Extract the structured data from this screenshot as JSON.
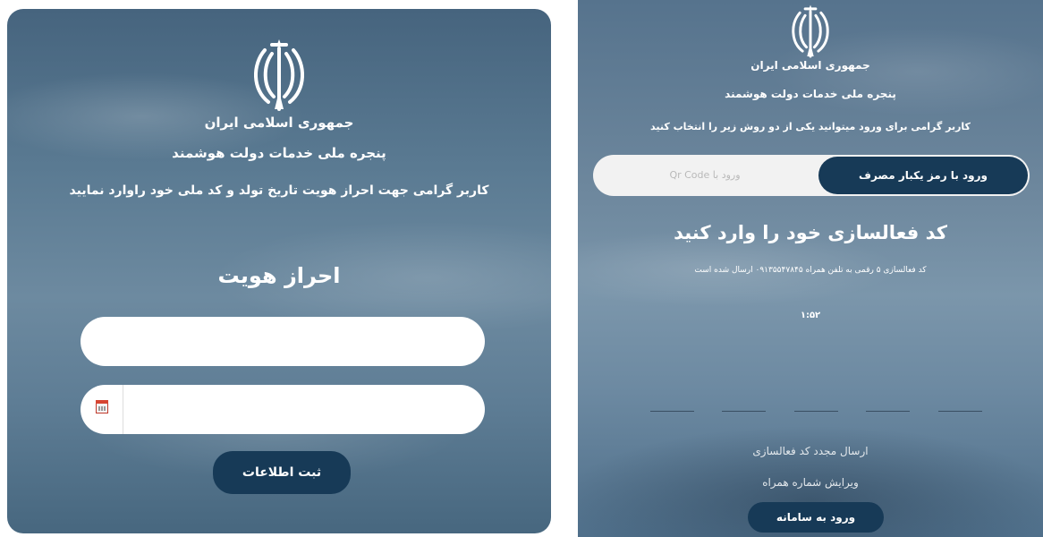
{
  "left_panel": {
    "country": "جمهوری اسلامی ایران",
    "portal": "پنجره ملی خدمات دولت هوشمند",
    "instruction": "کاربر گرامی جهت احراز هویت تاریخ تولد و کد ملی خود راوارد نمایید",
    "heading": "احراز هویت",
    "national_code_field": {
      "value": "",
      "placeholder": ""
    },
    "birth_date_field": {
      "value": "",
      "placeholder": "",
      "icon": "calendar-icon"
    },
    "submit_label": "ثبت اطلاعات"
  },
  "right_panel": {
    "country": "جمهوری اسلامی ایران",
    "portal": "پنجره ملی خدمات دولت هوشمند",
    "instruction": "کاربر گرامی برای ورود میتوانید یکی از دو روش زیر را انتخاب کنید",
    "toggle": {
      "active_label": "ورود با رمز یکبار مصرف",
      "inactive_label": "ورود با Qr Code"
    },
    "heading": "کد فعالسازی خود را وارد کنید",
    "sent_message": "کد فعالسازی ۵ رقمی به تلفن همراه ۰۹۱۳۵۵۴۷۸۴۵ ارسال شده است",
    "timer": "۱:۵۲",
    "otp_digits": [
      "",
      "",
      "",
      "",
      ""
    ],
    "resend_label": "ارسال مجدد کد فعالسازی",
    "edit_phone_label": "ویرایش شماره همراه",
    "login_label": "ورود به سامانه"
  },
  "colors": {
    "button_bg": "#173a57",
    "field_bg": "#ffffff",
    "toggle_bg": "#f2f2f2"
  }
}
